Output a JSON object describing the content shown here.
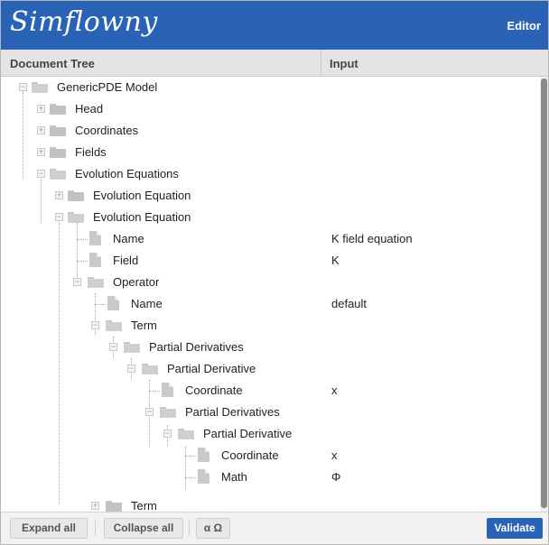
{
  "app": {
    "logo": "Simflowny",
    "mode": "Editor"
  },
  "columns": {
    "tree": "Document Tree",
    "input": "Input"
  },
  "tree": [
    {
      "label": "GenericPDE Model",
      "value": "",
      "kind": "folder",
      "state": "expanded"
    },
    {
      "label": "Head",
      "value": "",
      "kind": "folder",
      "state": "collapsed"
    },
    {
      "label": "Coordinates",
      "value": "",
      "kind": "folder",
      "state": "collapsed"
    },
    {
      "label": "Fields",
      "value": "",
      "kind": "folder",
      "state": "collapsed"
    },
    {
      "label": "Evolution Equations",
      "value": "",
      "kind": "folder",
      "state": "expanded"
    },
    {
      "label": "Evolution Equation",
      "value": "",
      "kind": "folder",
      "state": "collapsed"
    },
    {
      "label": "Evolution Equation",
      "value": "",
      "kind": "folder",
      "state": "expanded"
    },
    {
      "label": "Name",
      "value": "K field equation",
      "kind": "leaf",
      "state": ""
    },
    {
      "label": "Field",
      "value": "K",
      "kind": "leaf",
      "state": ""
    },
    {
      "label": "Operator",
      "value": "",
      "kind": "folder",
      "state": "expanded"
    },
    {
      "label": "Name",
      "value": "default",
      "kind": "leaf",
      "state": ""
    },
    {
      "label": "Term",
      "value": "",
      "kind": "folder",
      "state": "expanded"
    },
    {
      "label": "Partial Derivatives",
      "value": "",
      "kind": "folder",
      "state": "expanded"
    },
    {
      "label": "Partial Derivative",
      "value": "",
      "kind": "folder",
      "state": "expanded"
    },
    {
      "label": "Coordinate",
      "value": "x",
      "kind": "leaf",
      "state": ""
    },
    {
      "label": "Partial Derivatives",
      "value": "",
      "kind": "folder",
      "state": "expanded"
    },
    {
      "label": "Partial Derivative",
      "value": "",
      "kind": "folder",
      "state": "expanded"
    },
    {
      "label": "Coordinate",
      "value": "x",
      "kind": "leaf",
      "state": ""
    },
    {
      "label": "Math",
      "value": "Φ",
      "kind": "leaf",
      "state": ""
    },
    {
      "label": "Term",
      "value": "",
      "kind": "folder",
      "state": "collapsed"
    }
  ],
  "footer": {
    "expand_all": "Expand all",
    "collapse_all": "Collapse all",
    "symbols": "α Ω",
    "validate": "Validate"
  },
  "colors": {
    "brand": "#2a62b6",
    "icon_gray": "#c2c2c2"
  }
}
